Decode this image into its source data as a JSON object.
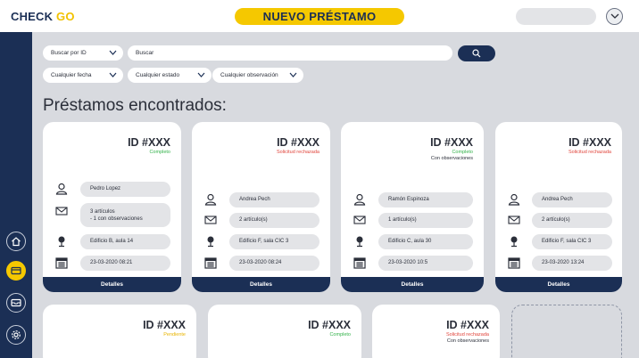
{
  "app": {
    "logo_prefix": "CHECK ",
    "logo_suffix": "GO",
    "page_title": "NUEVO PRÉSTAMO"
  },
  "colors": {
    "brand_navy": "#1b2f55",
    "brand_yellow": "#f5c800",
    "status_complete": "#33b24a",
    "status_rejected": "#e0433a",
    "status_pending": "#e8b400"
  },
  "sidebar": {
    "items": [
      {
        "icon": "home-icon"
      },
      {
        "icon": "loan-card-icon",
        "active": true
      },
      {
        "icon": "inbox-icon"
      },
      {
        "icon": "settings-icon"
      }
    ]
  },
  "filters": {
    "search_by": "Buscar por ID",
    "search_placeholder": "Buscar",
    "date": "Cualquier fecha",
    "state": "Cualquier estado",
    "observation": "Cualquier observación"
  },
  "results_heading": "Préstamos encontrados:",
  "cards": [
    {
      "id": "ID #XXX",
      "status": "Completo",
      "status_color": "#33b24a",
      "sub": "",
      "person": "Pedro Lopez",
      "articles": "3 artículos",
      "articles_note": "- 1 con observaciones",
      "location": "Edificio B, aula 14",
      "date": "23-03-2020 08:21",
      "button": "Detalles"
    },
    {
      "id": "ID #XXX",
      "status": "Solicitud rechazada",
      "status_color": "#e0433a",
      "sub": "",
      "person": "Andrea Pech",
      "articles": "2 artículo(s)",
      "articles_note": "",
      "location": "Edificio F, sala CIC 3",
      "date": "23-03-2020 08:24",
      "button": "Detalles"
    },
    {
      "id": "ID #XXX",
      "status": "Completo",
      "status_color": "#33b24a",
      "sub": "Con observaciones",
      "person": "Ramón Espinoza",
      "articles": "1 artículo(s)",
      "articles_note": "",
      "location": "Edificio C, aula 30",
      "date": "23-03-2020 10:5",
      "button": "Detalles"
    },
    {
      "id": "ID #XXX",
      "status": "Solicitud rechazada",
      "status_color": "#e0433a",
      "sub": "",
      "person": "Andrea Pech",
      "articles": "2 artículo(s)",
      "articles_note": "",
      "location": "Edificio F, sala CIC 3",
      "date": "23-03-2020 13:24",
      "button": "Detalles"
    },
    {
      "id": "ID #XXX",
      "status": "Pendiente",
      "status_color": "#e8b400",
      "sub": ""
    },
    {
      "id": "ID #XXX",
      "status": "Completo",
      "status_color": "#33b24a",
      "sub": ""
    },
    {
      "id": "ID #XXX",
      "status": "Solicitud rechazada",
      "status_color": "#e0433a",
      "sub": "Con observaciones"
    }
  ]
}
